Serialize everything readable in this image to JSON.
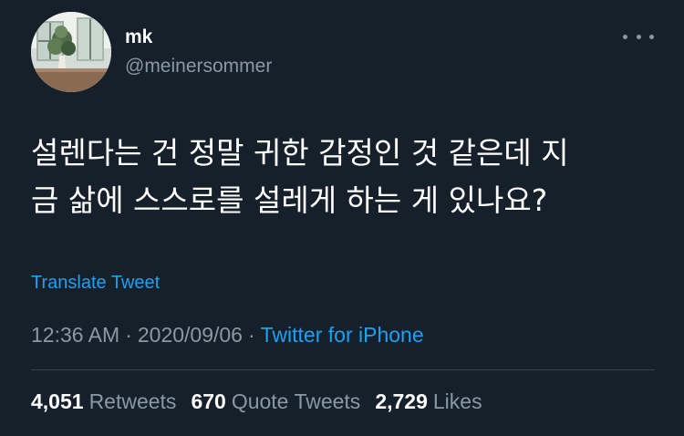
{
  "user": {
    "display_name": "mk",
    "handle": "@meinersommer"
  },
  "tweet": {
    "lines": [
      "설렌다는 건 정말 귀한 감정인 것 같은데 지",
      "금 삶에 스스로를 설레게 하는 게 있나요?"
    ],
    "translate_label": "Translate Tweet",
    "time": "12:36 AM",
    "separator": "·",
    "date": "2020/09/06",
    "source": "Twitter for iPhone"
  },
  "stats": {
    "retweets": {
      "count": "4,051",
      "label": "Retweets"
    },
    "quote_tweets": {
      "count": "670",
      "label": "Quote Tweets"
    },
    "likes": {
      "count": "2,729",
      "label": "Likes"
    }
  },
  "icons": {
    "more": "more-horizontal-icon",
    "avatar": "profile-photo"
  },
  "colors": {
    "background": "#15202b",
    "text": "#ffffff",
    "secondary": "#8899a6",
    "link": "#1da1f2",
    "divider": "#38444d"
  }
}
